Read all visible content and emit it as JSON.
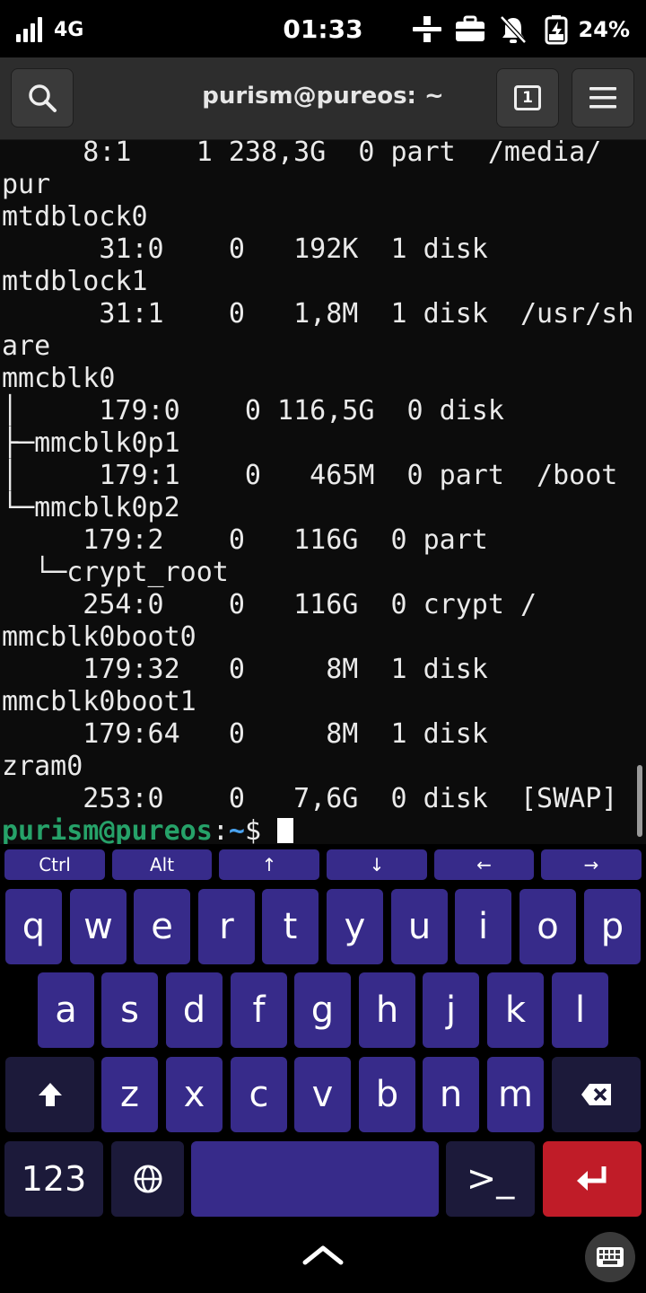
{
  "status": {
    "network": "4G",
    "time": "01:33",
    "battery": "24%"
  },
  "header": {
    "title": "purism@pureos: ~",
    "tab_count": "1"
  },
  "terminal": {
    "lines": [
      "     8:1    1 238,3G  0 part  /media/",
      "pur",
      "mtdblock0",
      "      31:0    0   192K  1 disk",
      "mtdblock1",
      "      31:1    0   1,8M  1 disk  /usr/sh",
      "are",
      "mmcblk0",
      "│     179:0    0 116,5G  0 disk",
      "├─mmcblk0p1",
      "│     179:1    0   465M  0 part  /boot",
      "└─mmcblk0p2",
      "     179:2    0   116G  0 part",
      "  └─crypt_root",
      "     254:0    0   116G  0 crypt /",
      "mmcblk0boot0",
      "     179:32   0     8M  1 disk",
      "mmcblk0boot1",
      "     179:64   0     8M  1 disk",
      "zram0",
      "     253:0    0   7,6G  0 disk  [SWAP]"
    ],
    "prompt_user": "purism@pureos",
    "prompt_sep": ":",
    "prompt_path": "~",
    "prompt_symbol": "$ "
  },
  "keyboard": {
    "function_row": [
      "Ctrl",
      "Alt",
      "↑",
      "↓",
      "←",
      "→"
    ],
    "row1": [
      "q",
      "w",
      "e",
      "r",
      "t",
      "y",
      "u",
      "i",
      "o",
      "p"
    ],
    "row2": [
      "a",
      "s",
      "d",
      "f",
      "g",
      "h",
      "j",
      "k",
      "l"
    ],
    "row3": [
      "z",
      "x",
      "c",
      "v",
      "b",
      "n",
      "m"
    ],
    "numbers_label": "123",
    "terminal_key_label": ">_"
  },
  "colors": {
    "terminal_bg": "#0c0c0c",
    "prompt_user": "#26a269",
    "prompt_path": "#4aa3f0",
    "key": "#372b8a",
    "key_dark": "#1c1a3a",
    "enter_key": "#c01c28"
  },
  "icons": [
    "signal-icon",
    "ethernet-icon",
    "briefcase-icon",
    "bell-off-icon",
    "battery-charging-icon",
    "search-icon",
    "tabs-icon",
    "menu-icon",
    "shift-icon",
    "backspace-icon",
    "globe-icon",
    "enter-icon",
    "chevron-up-icon",
    "keyboard-icon"
  ]
}
